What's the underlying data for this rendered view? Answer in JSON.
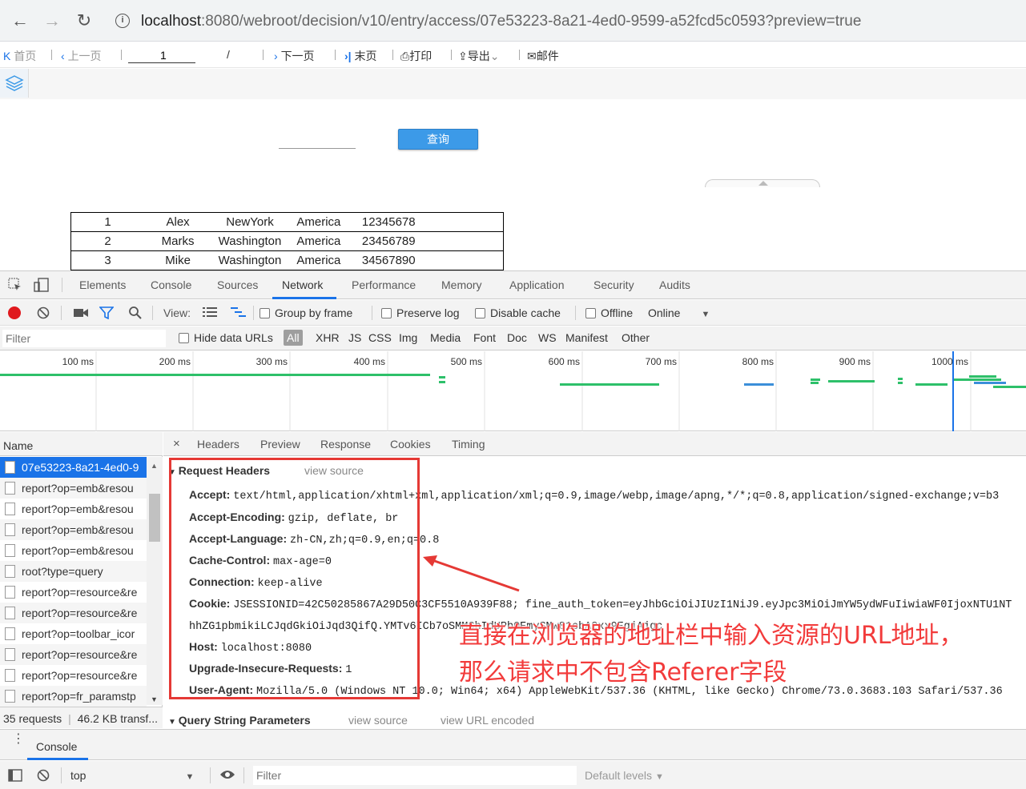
{
  "browser": {
    "info_glyph": "i",
    "url_host": "localhost",
    "url_rest": ":8080/webroot/decision/v10/entry/access/07e53223-8a21-4ed0-9599-a52fcd5c0593?preview=true"
  },
  "report_toolbar": {
    "first": "首页",
    "prev": "上一页",
    "page_value": "1",
    "page_sep": "/",
    "next": "下一页",
    "last": "末页",
    "print": "打印",
    "export": "导出",
    "mail": "邮件"
  },
  "query": {
    "button": "查询"
  },
  "table": {
    "rows": [
      [
        "1",
        "Alex",
        "NewYork",
        "America",
        "12345678"
      ],
      [
        "2",
        "Marks",
        "Washington",
        "America",
        "23456789"
      ],
      [
        "3",
        "Mike",
        "Washington",
        "America",
        "34567890"
      ]
    ]
  },
  "devtools": {
    "tabs": [
      "Elements",
      "Console",
      "Sources",
      "Network",
      "Performance",
      "Memory",
      "Application",
      "Security",
      "Audits"
    ],
    "toolbar": {
      "view": "View:",
      "group_by_frame": "Group by frame",
      "preserve_log": "Preserve log",
      "disable_cache": "Disable cache",
      "offline": "Offline",
      "online": "Online"
    },
    "filter": {
      "placeholder": "Filter",
      "hide_data_urls": "Hide data URLs",
      "types": [
        "All",
        "XHR",
        "JS",
        "CSS",
        "Img",
        "Media",
        "Font",
        "Doc",
        "WS",
        "Manifest",
        "Other"
      ]
    },
    "timeline_ticks": [
      "100 ms",
      "200 ms",
      "300 ms",
      "400 ms",
      "500 ms",
      "600 ms",
      "700 ms",
      "800 ms",
      "900 ms",
      "1000 ms"
    ],
    "requests_header": "Name",
    "requests": [
      "07e53223-8a21-4ed0-9",
      "report?op=emb&resou",
      "report?op=emb&resou",
      "report?op=emb&resou",
      "report?op=emb&resou",
      "root?type=query",
      "report?op=resource&re",
      "report?op=resource&re",
      "report?op=toolbar_icor",
      "report?op=resource&re",
      "report?op=resource&re",
      "report?op=fr_paramstp"
    ],
    "summary_requests": "35 requests",
    "summary_transfer": "46.2 KB transf...",
    "detail_tabs": [
      "Headers",
      "Preview",
      "Response",
      "Cookies",
      "Timing"
    ],
    "request_headers_title": "Request Headers",
    "view_source": "view source",
    "headers": [
      {
        "k": "Accept:",
        "v": "text/html,application/xhtml+xml,application/xml;q=0.9,image/webp,image/apng,*/*;q=0.8,application/signed-exchange;v=b3"
      },
      {
        "k": "Accept-Encoding:",
        "v": "gzip, deflate, br"
      },
      {
        "k": "Accept-Language:",
        "v": "zh-CN,zh;q=0.9,en;q=0.8"
      },
      {
        "k": "Cache-Control:",
        "v": "max-age=0"
      },
      {
        "k": "Connection:",
        "v": "keep-alive"
      },
      {
        "k": "Cookie:",
        "v": "JSESSIONID=42C50285867A29D50C3CF5510A939F88; fine_auth_token=eyJhbGciOiJIUzI1NiJ9.eyJpc3MiOiJmYW5ydWFuIiwiaWF0IjoxNTU1NT"
      },
      {
        "k": "",
        "v": "hhZG1pbmikiLCJqdGkiOiJqd3QifQ.YMTv6ICb7oSMMChIdUPbOEmySMw81cbA2xx9EgjAjgc"
      },
      {
        "k": "Host:",
        "v": "localhost:8080"
      },
      {
        "k": "Upgrade-Insecure-Requests:",
        "v": "1"
      },
      {
        "k": "User-Agent:",
        "v": "Mozilla/5.0 (Windows NT 10.0; Win64; x64) AppleWebKit/537.36 (KHTML, like Gecko) Chrome/73.0.3683.103 Safari/537.36"
      }
    ],
    "query_string_title": "Query String Parameters",
    "view_url_encoded": "view URL encoded",
    "console": {
      "tab": "Console",
      "context": "top",
      "filter_placeholder": "Filter",
      "levels": "Default levels"
    }
  },
  "annotation": {
    "line1": "直接在浏览器的地址栏中输入资源的URL地址，",
    "line2": "那么请求中不包含Referer字段",
    "color": "#f23b3b"
  }
}
